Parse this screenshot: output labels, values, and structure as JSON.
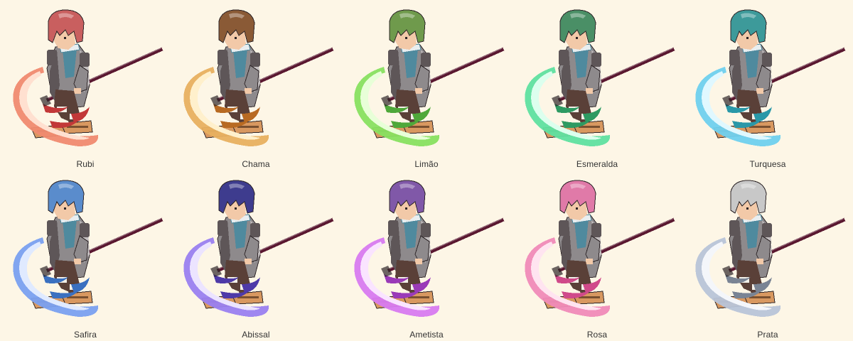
{
  "variants": [
    {
      "name": "Rubi",
      "hair": "#c95f5f",
      "glow": "#f08a70",
      "glow_light": "#ffe0d0",
      "accent": "#c23838"
    },
    {
      "name": "Chama",
      "hair": "#8a5a36",
      "glow": "#e8b060",
      "glow_light": "#fff0cc",
      "accent": "#b86a22"
    },
    {
      "name": "Limão",
      "hair": "#6f9a4c",
      "glow": "#88e060",
      "glow_light": "#e8ffd8",
      "accent": "#4fa83a"
    },
    {
      "name": "Esmeralda",
      "hair": "#4a8f66",
      "glow": "#5fe0a0",
      "glow_light": "#dcffee",
      "accent": "#2e9a62"
    },
    {
      "name": "Turquesa",
      "hair": "#3d9a9a",
      "glow": "#6fd0ee",
      "glow_light": "#e0f8ff",
      "accent": "#2a98a8"
    },
    {
      "name": "Safira",
      "hair": "#5a8ccc",
      "glow": "#7aa0f0",
      "glow_light": "#e0eaff",
      "accent": "#3a70c0"
    },
    {
      "name": "Abissal",
      "hair": "#3e3c8e",
      "glow": "#9a80f0",
      "glow_light": "#ece4ff",
      "accent": "#4e3aa8"
    },
    {
      "name": "Ametista",
      "hair": "#8058a8",
      "glow": "#d87af0",
      "glow_light": "#fae4ff",
      "accent": "#9a3ab8"
    },
    {
      "name": "Rosa",
      "hair": "#e07aa8",
      "glow": "#f08ab8",
      "glow_light": "#ffe4f0",
      "accent": "#d04a8a"
    },
    {
      "name": "Prata",
      "hair": "#c8c8c8",
      "glow": "#b8c4d8",
      "glow_light": "#f4f6fa",
      "accent": "#7a8494"
    }
  ],
  "palette": {
    "background": "#fdf6e6",
    "coat": "#8e8a8c",
    "coat_dark": "#5e5658",
    "coat_light": "#c4bfc0",
    "scarf": "#4f8a9e",
    "skin": "#f2c9a8",
    "pants": "#5a4038",
    "boots": "#d89860",
    "staff": "#5a1830",
    "outline": "#2e2628"
  }
}
